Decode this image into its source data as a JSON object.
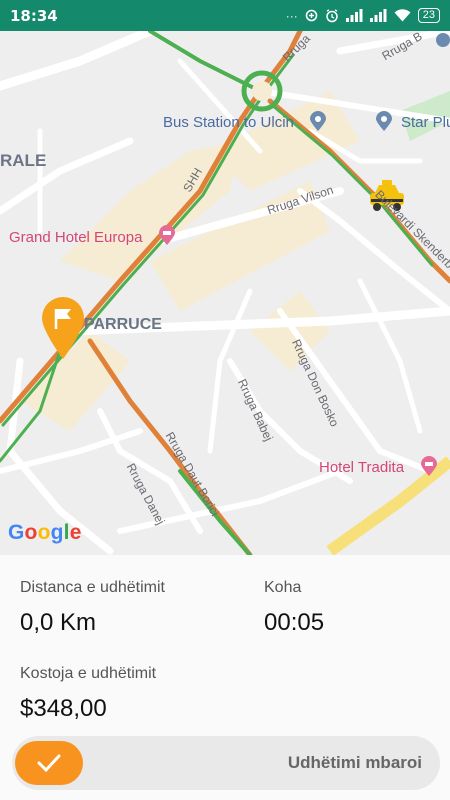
{
  "status_bar": {
    "time": "18:34",
    "battery": "23",
    "icons": [
      "dots-icon",
      "data-saver-icon",
      "alarm-icon",
      "signal-icon",
      "signal-icon",
      "wifi-icon",
      "battery-icon"
    ]
  },
  "map": {
    "labels": {
      "bus_station": "Bus Station to Ulcin",
      "star_plus": "Star Plu",
      "rale": "RALE",
      "rruga_vilson": "Rruga Vilson",
      "grand_hotel": "Grand Hotel Europa",
      "parruce": "PARRUCE",
      "rruga_don_bosko": "Rruga Don Bosko",
      "rruga_babej": "Rruga Babej",
      "rruga_daut_borici": "Rruga Daut Borici",
      "rruga_danej": "Rruga Danej",
      "hotel_tradita": "Hotel Tradita",
      "bulevardi": "Bulevardi Skenderbeu",
      "shh": "SHH",
      "rruga_top1": "Rruga",
      "rruga_top2": "Rruga B"
    },
    "google": {
      "G": "G",
      "o1": "o",
      "o2": "o",
      "g": "g",
      "l": "l",
      "e": "e"
    },
    "colors": {
      "google_blue": "#4285f4",
      "google_red": "#ea4335",
      "google_yellow": "#fbbc05",
      "google_green": "#34a853"
    }
  },
  "trip": {
    "distance_label": "Distanca e udhëtimit",
    "distance_value": "0,0 Km",
    "time_label": "Koha",
    "time_value": "00:05",
    "cost_label": "Kostoja e udhëtimit",
    "cost_value": "$348,00"
  },
  "slider": {
    "label": "Udhëtimi mbaroi",
    "accent": "#f7931e"
  }
}
